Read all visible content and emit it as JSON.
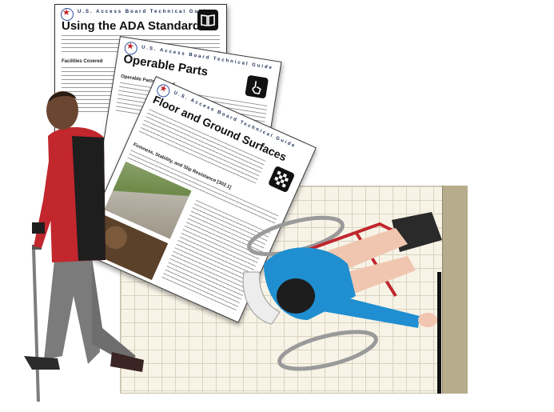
{
  "documents": [
    {
      "header": "U.S. Access Board Technical Guide",
      "title": "Using the ADA Standards",
      "icon": "book-icon",
      "subheading": "Facilities Covered"
    },
    {
      "header": "U.S. Access Board Technical Guide",
      "title": "Operable Parts",
      "icon": "hand-pointer-icon",
      "subheading": "Operable Parts Covered"
    },
    {
      "header": "U.S. Access Board Technical Guide",
      "title": "Floor and Ground Surfaces",
      "icon": "checkered-floor-icon",
      "subheading": "Firmness, Stability, and Slip Resistance [302.1]"
    }
  ],
  "colors": {
    "floor": "#f7f3e6",
    "wall": "#b7ac8c",
    "shirt": "#c1272d",
    "wheelchair_frame": "#c0262d",
    "blouse": "#1f8fd1"
  }
}
